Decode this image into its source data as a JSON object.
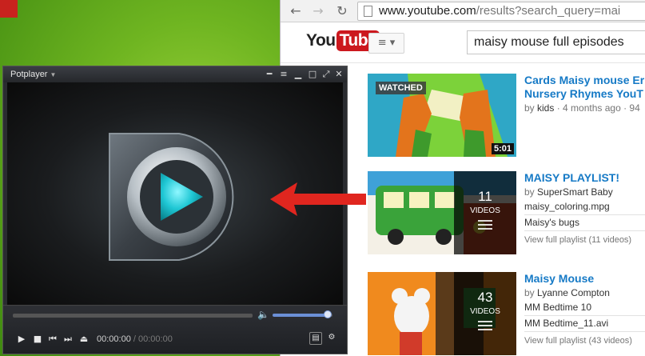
{
  "browser": {
    "url_host": "www.youtube.com",
    "url_path": "/results?search_query=mai",
    "search_value": "maisy mouse full episodes",
    "logo_you": "You",
    "logo_tube": "Tube",
    "guide_label": "≡ ▾"
  },
  "results": [
    {
      "title": "Cards Maisy mouse Er",
      "title2": "Nursery Rhymes YouT",
      "by": "kids",
      "age": "4 months ago",
      "views": "94",
      "watched_label": "WATCHED",
      "duration": "5:01"
    },
    {
      "title": "MAISY PLAYLIST!",
      "by": "SuperSmart Baby",
      "count": "11",
      "count_label": "VIDEOS",
      "items": [
        "maisy_coloring.mpg",
        "Maisy's bugs"
      ],
      "view_full": "View full playlist (11 videos)"
    },
    {
      "title": "Maisy Mouse",
      "by": "Lyanne Compton",
      "count": "43",
      "count_label": "VIDEOS",
      "items": [
        "MM Bedtime 10",
        "MM Bedtime_11.avi"
      ],
      "view_full": "View full playlist (43 videos)"
    }
  ],
  "player": {
    "name": "Potplayer",
    "current_time": "00:00:00",
    "separator": "/",
    "duration": "00:00:00",
    "volume_fraction": 0.92
  },
  "colors": {
    "accent_link": "#167ac6",
    "youtube_red": "#cc181e",
    "arrow_red": "#e0261f",
    "player_teal": "#1fc7d4"
  }
}
